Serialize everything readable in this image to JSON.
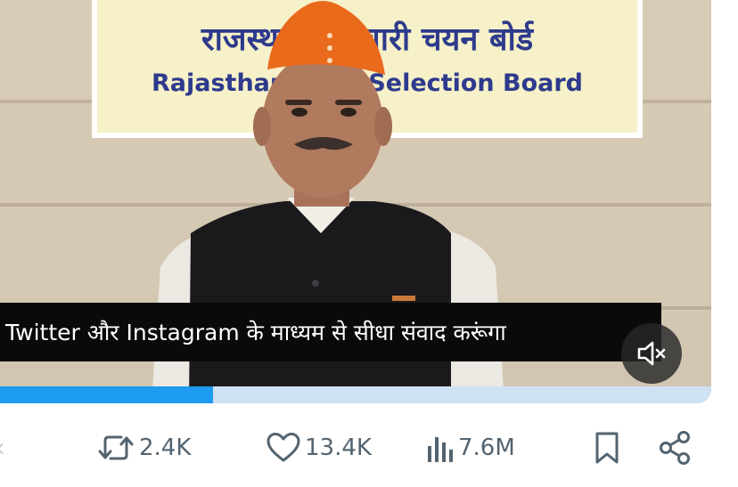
{
  "video": {
    "sign": {
      "hindi": "राजस्थान कर्मचारी चयन बोर्ड",
      "english": "Rajasthan Staff Selection Board"
    },
    "caption": "Twitter और Instagram के माध्यम से सीधा संवाद करूंगा",
    "progress": 0.3,
    "muted": true
  },
  "actions": {
    "retweet_count": "2.4K",
    "like_count": "13.4K",
    "view_count": "7.6M"
  },
  "colors": {
    "accent": "#1d9bf0",
    "icon_gray": "#536471",
    "sign_text": "#2e3a8c"
  },
  "icons": [
    "retweet-icon",
    "heart-icon",
    "views-icon",
    "bookmark-icon",
    "share-icon",
    "mute-icon"
  ]
}
